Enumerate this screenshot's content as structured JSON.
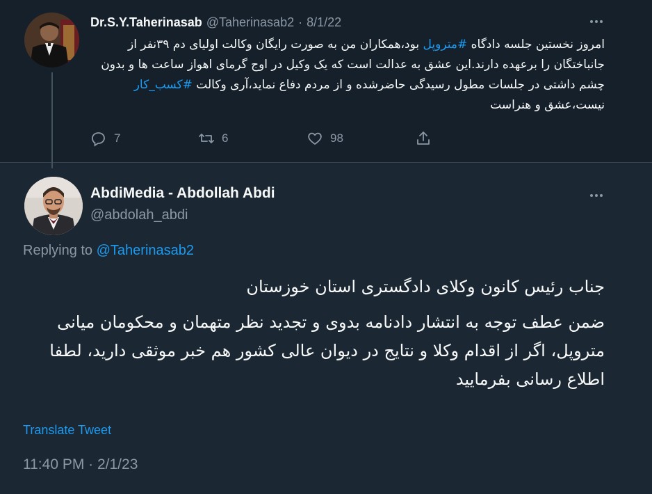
{
  "parent_tweet": {
    "display_name": "Dr.S.Y.Taherinasab",
    "handle": "@Taherinasab2",
    "separator": "·",
    "date": "8/1/22",
    "text_segments": [
      "امروز نخستین جلسه دادگاه ",
      "#متروپل",
      " بود،همکاران من به صورت رایگان وکالت اولیای دم ۳۹نفر از جانباختگان را برعهده دارند.این عشق به عدالت است که یک وکیل در اوج گرمای اهواز ساعت ها و بدون چشم داشتی در جلسات مطول رسیدگی حاضرشده و از مردم دفاع نماید،آری وکالت ",
      "#کسب_کار",
      " نیست،عشق و هنراست"
    ],
    "reply_count": "7",
    "retweet_count": "6",
    "like_count": "98",
    "icons": [
      "reply-icon",
      "retweet-icon",
      "like-icon",
      "share-icon",
      "more-icon"
    ]
  },
  "main_tweet": {
    "display_name": "AbdiMedia - Abdollah Abdi",
    "handle": "@abdolah_abdi",
    "replying_prefix": "Replying to ",
    "replying_to": "@Taherinasab2",
    "paragraphs": [
      "جناب رئیس کانون وکلای دادگستری استان خوزستان",
      "ضمن عطف توجه به انتشار دادنامه بدوی و تجدید نظر متهمان و محکومان میانی متروپل، اگر از اقدام وکلا و نتایج در دیوان عالی کشور هم خبر موثقی دارید، لطفا اطلاع رسانی بفرمایید"
    ],
    "translate_label": "Translate Tweet",
    "timestamp": "11:40 PM · 2/1/23"
  },
  "colors": {
    "background_parent": "#15202b",
    "background_main": "#1b2733",
    "text_primary": "#f7f9f9",
    "text_secondary": "#8b98a5",
    "accent": "#1d9bf0"
  }
}
